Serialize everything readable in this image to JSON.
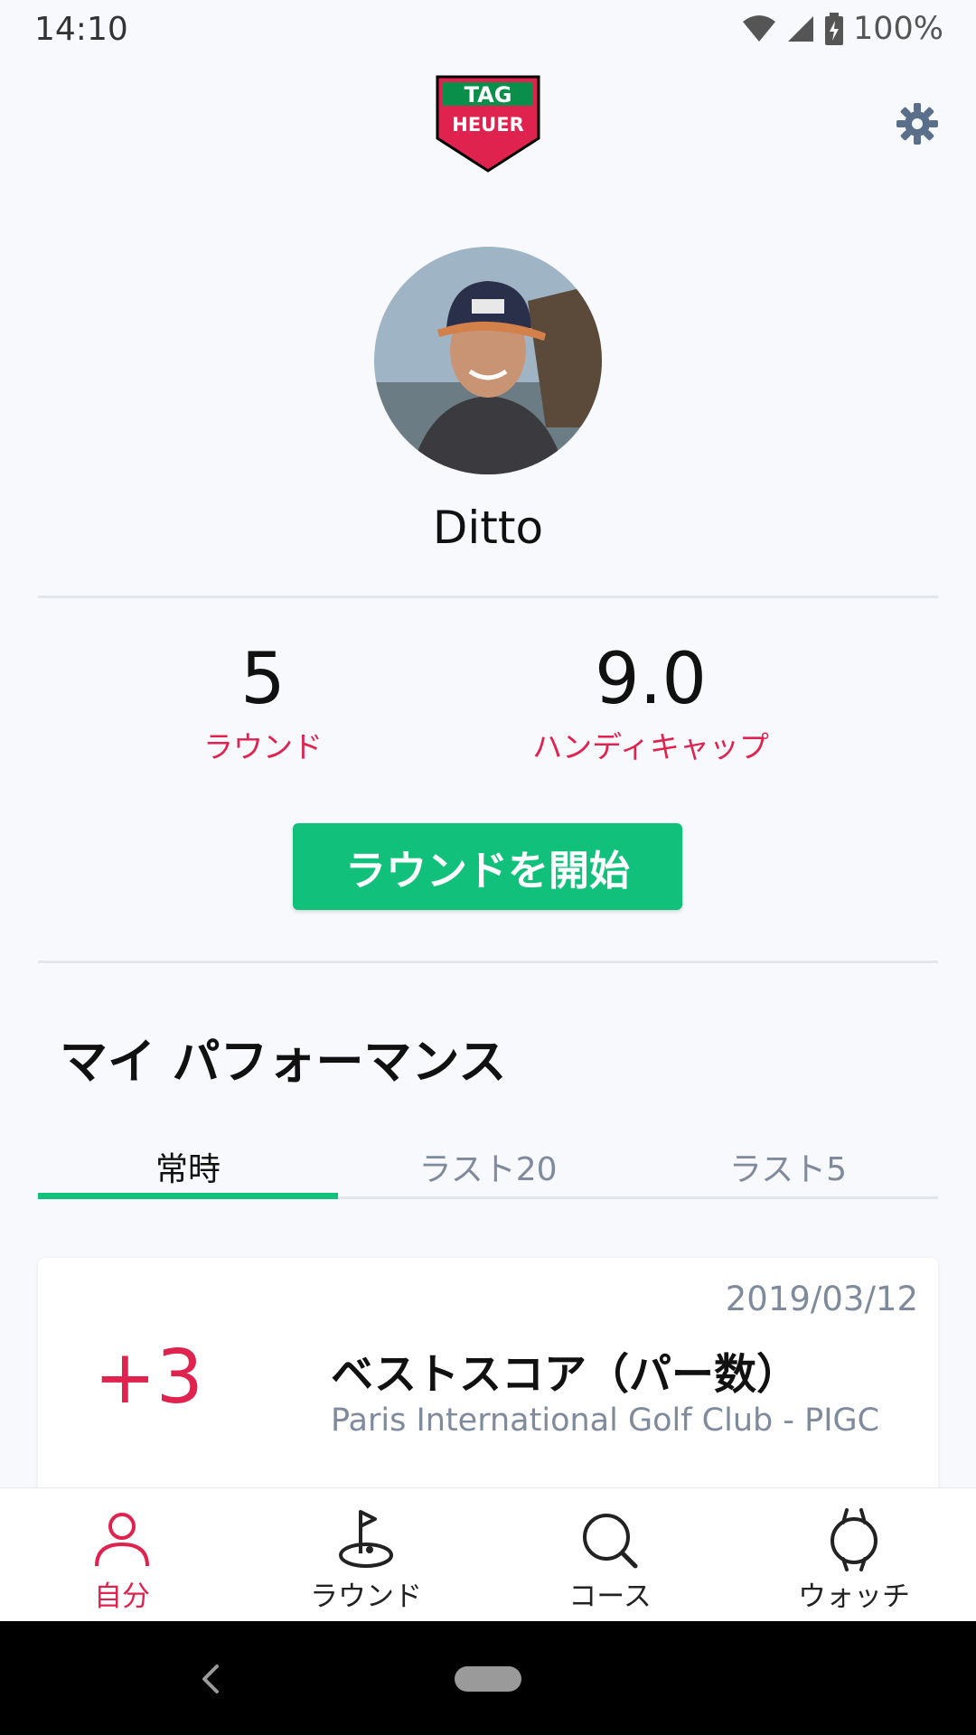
{
  "status_bar": {
    "time": "14:10",
    "battery": "100%"
  },
  "user": {
    "name": "Ditto"
  },
  "stats": [
    {
      "value": "5",
      "label": "ラウンド"
    },
    {
      "value": "9.0",
      "label": "ハンディキャップ"
    }
  ],
  "start_button": {
    "label": "ラウンドを開始"
  },
  "performance": {
    "title": "マイ パフォーマンス",
    "tabs": [
      {
        "label": "常時",
        "active": true
      },
      {
        "label": "ラスト20",
        "active": false
      },
      {
        "label": "ラスト5",
        "active": false
      }
    ],
    "card": {
      "score": "+3",
      "date": "2019/03/12",
      "title": "ベストスコア（パー数）",
      "course": "Paris International Golf Club - PIGC"
    }
  },
  "bottom_nav": [
    {
      "label": "自分",
      "icon": "person-icon",
      "active": true
    },
    {
      "label": "ラウンド",
      "icon": "golf-flag-icon",
      "active": false
    },
    {
      "label": "コース",
      "icon": "search-icon",
      "active": false
    },
    {
      "label": "ウォッチ",
      "icon": "watch-icon",
      "active": false
    }
  ],
  "colors": {
    "accent": "#e0224e",
    "primary": "#11c07b",
    "muted": "#7f8a9c"
  }
}
